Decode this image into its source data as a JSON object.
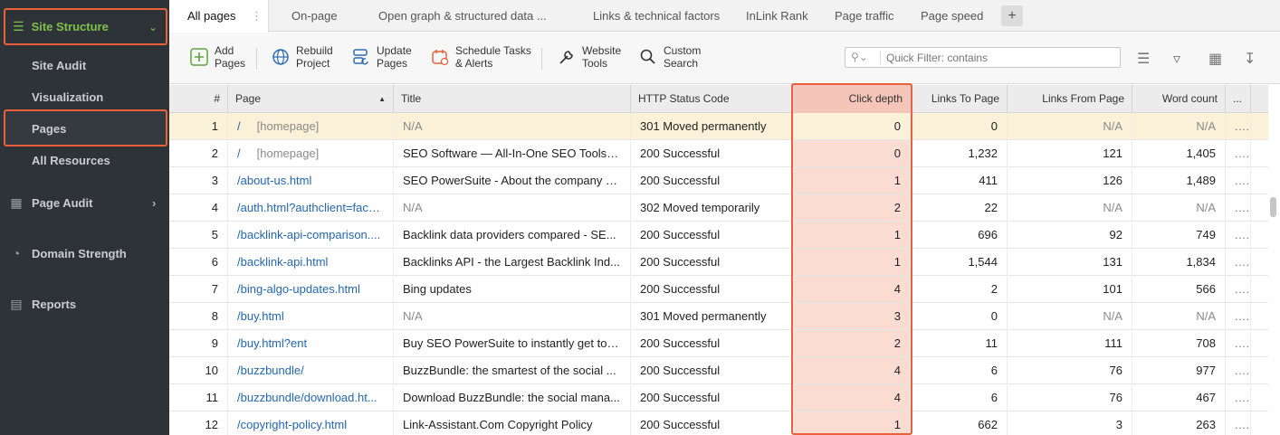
{
  "sidebar": {
    "section": "Site Structure",
    "sub_items": [
      "Site Audit",
      "Visualization",
      "Pages",
      "All Resources"
    ],
    "main_items": [
      "Page Audit",
      "Domain Strength",
      "Reports"
    ]
  },
  "tabs": [
    "All pages",
    "On-page",
    "Open graph & structured data ...",
    "Links & technical factors",
    "InLink Rank",
    "Page traffic",
    "Page speed"
  ],
  "tab_plus": "+",
  "toolbar": {
    "add": "Add\nPages",
    "rebuild": "Rebuild\nProject",
    "update": "Update\nPages",
    "schedule": "Schedule Tasks\n& Alerts",
    "website": "Website\nTools",
    "custom": "Custom\nSearch",
    "filter_placeholder": "Quick Filter: contains"
  },
  "columns": [
    "#",
    "Page",
    "Title",
    "HTTP Status Code",
    "Click depth",
    "Links To Page",
    "Links From Page",
    "Word count",
    "..."
  ],
  "rows": [
    {
      "n": "1",
      "page": "/",
      "tag": "[homepage]",
      "title": "N/A",
      "status": "301 Moved permanently",
      "depth": "0",
      "to": "0",
      "from": "N/A",
      "words": "N/A"
    },
    {
      "n": "2",
      "page": "/",
      "tag": "[homepage]",
      "title": "SEO Software — All-In-One SEO Tools f...",
      "status": "200 Successful",
      "depth": "0",
      "to": "1,232",
      "from": "121",
      "words": "1,405"
    },
    {
      "n": "3",
      "page": "/about-us.html",
      "tag": "",
      "title": "SEO PowerSuite - About the company a...",
      "status": "200 Successful",
      "depth": "1",
      "to": "411",
      "from": "126",
      "words": "1,489"
    },
    {
      "n": "4",
      "page": "/auth.html?authclient=face...",
      "tag": "",
      "title": "N/A",
      "status": "302 Moved temporarily",
      "depth": "2",
      "to": "22",
      "from": "N/A",
      "words": "N/A"
    },
    {
      "n": "5",
      "page": "/backlink-api-comparison....",
      "tag": "",
      "title": "Backlink data providers compared - SE...",
      "status": "200 Successful",
      "depth": "1",
      "to": "696",
      "from": "92",
      "words": "749"
    },
    {
      "n": "6",
      "page": "/backlink-api.html",
      "tag": "",
      "title": "Backlinks API - the Largest Backlink Ind...",
      "status": "200 Successful",
      "depth": "1",
      "to": "1,544",
      "from": "131",
      "words": "1,834"
    },
    {
      "n": "7",
      "page": "/bing-algo-updates.html",
      "tag": "",
      "title": "Bing updates",
      "status": "200 Successful",
      "depth": "4",
      "to": "2",
      "from": "101",
      "words": "566"
    },
    {
      "n": "8",
      "page": "/buy.html",
      "tag": "",
      "title": "N/A",
      "status": "301 Moved permanently",
      "depth": "3",
      "to": "0",
      "from": "N/A",
      "words": "N/A"
    },
    {
      "n": "9",
      "page": "/buy.html?ent",
      "tag": "",
      "title": "Buy SEO PowerSuite to instantly get top ...",
      "status": "200 Successful",
      "depth": "2",
      "to": "11",
      "from": "111",
      "words": "708"
    },
    {
      "n": "10",
      "page": "/buzzbundle/",
      "tag": "",
      "title": "BuzzBundle: the smartest of the social ...",
      "status": "200 Successful",
      "depth": "4",
      "to": "6",
      "from": "76",
      "words": "977"
    },
    {
      "n": "11",
      "page": "/buzzbundle/download.ht...",
      "tag": "",
      "title": "Download BuzzBundle: the social mana...",
      "status": "200 Successful",
      "depth": "4",
      "to": "6",
      "from": "76",
      "words": "467"
    },
    {
      "n": "12",
      "page": "/copyright-policy.html",
      "tag": "",
      "title": "Link-Assistant.Com Copyright Policy",
      "status": "200 Successful",
      "depth": "1",
      "to": "662",
      "from": "3",
      "words": "263"
    }
  ],
  "row_more": "...",
  "colors": {
    "accent": "#e8613a",
    "sidebar_bg": "#2e3338",
    "green": "#7ec24b",
    "link": "#2467b0"
  }
}
